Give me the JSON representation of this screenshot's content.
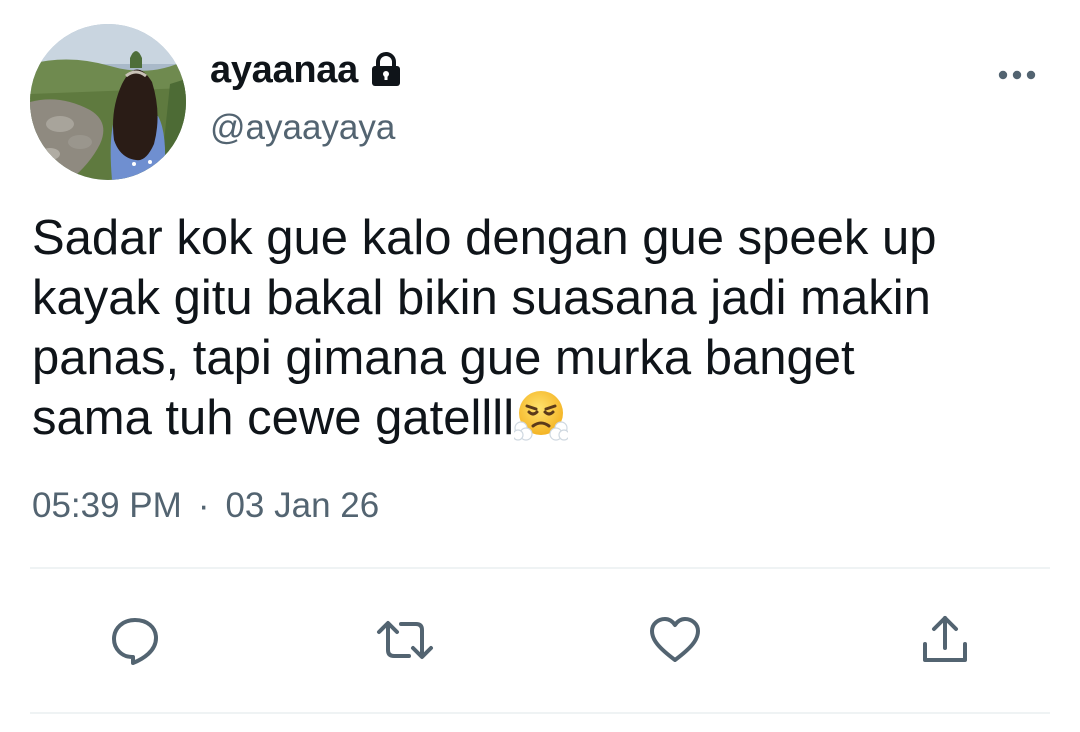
{
  "profile": {
    "display_name": "ayaanaa",
    "handle": "@ayaayaya",
    "protected_icon": "lock-icon",
    "avatar": "avatar"
  },
  "tweet": {
    "text": "Sadar kok gue kalo dengan gue speek up\nkayak gitu bakal bikin suasana jadi makin\npanas, tapi gimana gue murka banget\nsama tuh cewe gatellll",
    "emoji_icon": "face-with-steam-from-nose-emoji",
    "time": "05:39 PM",
    "separator": "·",
    "date": "03 Jan 26"
  },
  "actions": [
    {
      "name": "reply",
      "icon": "reply-icon"
    },
    {
      "name": "retweet",
      "icon": "retweet-icon"
    },
    {
      "name": "like",
      "icon": "heart-icon"
    },
    {
      "name": "share",
      "icon": "share-icon"
    }
  ],
  "menu_icon": "more-icon",
  "colors": {
    "text_primary": "#0f1419",
    "text_secondary": "#536471",
    "divider": "#eff3f4"
  }
}
